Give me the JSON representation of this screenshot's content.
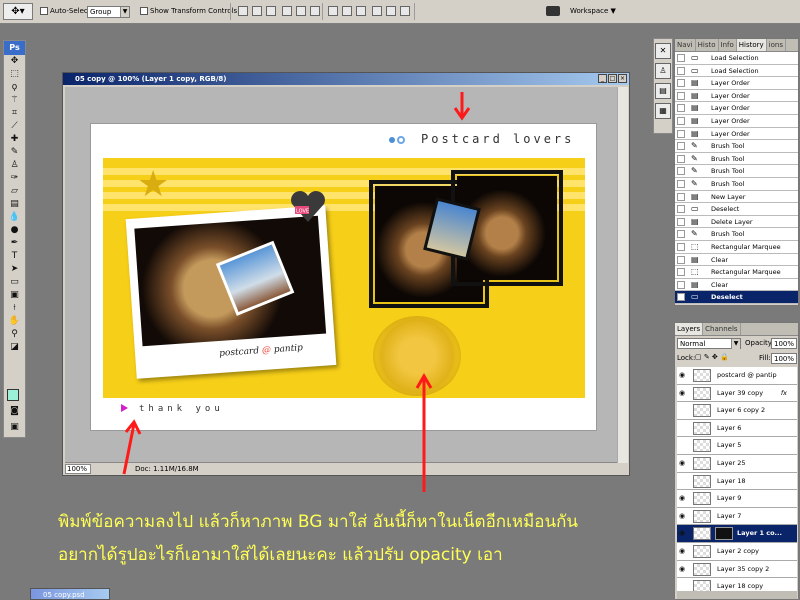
{
  "options_bar": {
    "tool_preset_icon": "move-tool-icon",
    "auto_select_label": "Auto-Select:",
    "auto_select_value": "Group",
    "show_transform_label": "Show Transform Controls",
    "workspace_label": "Workspace"
  },
  "toolbox": {
    "logo": "Ps",
    "foreground_color": "#9cf0d6",
    "tools": [
      "move-tool",
      "marquee-tool",
      "lasso-tool",
      "magic-wand-tool",
      "crop-tool",
      "slice-tool",
      "healing-brush-tool",
      "brush-tool",
      "clone-stamp-tool",
      "history-brush-tool",
      "eraser-tool",
      "gradient-tool",
      "blur-tool",
      "dodge-tool",
      "pen-tool",
      "type-tool",
      "path-selection-tool",
      "shape-tool",
      "notes-tool",
      "eyedropper-tool",
      "hand-tool",
      "zoom-tool"
    ]
  },
  "document": {
    "title": "05 copy @ 100% (Layer 1 copy, RGB/8)",
    "zoom": "100%",
    "doc_info": "Doc: 1.11M/16.8M",
    "brand_text": "Postcard lovers",
    "photo_caption_pre": "postcard",
    "photo_caption_at": "@",
    "photo_caption_post": "pantip",
    "heart_label": "LOVE",
    "thank_text": "thank you"
  },
  "history_panel": {
    "tabs": [
      "Navi",
      "Histo",
      "Info",
      "History",
      "ions"
    ],
    "active_tab": "History",
    "steps": [
      {
        "label": "Load Selection",
        "icon": "selection-icon"
      },
      {
        "label": "Load Selection",
        "icon": "selection-icon"
      },
      {
        "label": "Layer Order",
        "icon": "layer-icon"
      },
      {
        "label": "Layer Order",
        "icon": "layer-icon"
      },
      {
        "label": "Layer Order",
        "icon": "layer-icon"
      },
      {
        "label": "Layer Order",
        "icon": "layer-icon"
      },
      {
        "label": "Layer Order",
        "icon": "layer-icon"
      },
      {
        "label": "Brush Tool",
        "icon": "brush-icon"
      },
      {
        "label": "Brush Tool",
        "icon": "brush-icon"
      },
      {
        "label": "Brush Tool",
        "icon": "brush-icon"
      },
      {
        "label": "Brush Tool",
        "icon": "brush-icon"
      },
      {
        "label": "New Layer",
        "icon": "layer-icon"
      },
      {
        "label": "Deselect",
        "icon": "selection-icon"
      },
      {
        "label": "Delete Layer",
        "icon": "layer-icon"
      },
      {
        "label": "Brush Tool",
        "icon": "brush-icon"
      },
      {
        "label": "Rectangular Marquee",
        "icon": "marquee-icon"
      },
      {
        "label": "Clear",
        "icon": "layer-icon"
      },
      {
        "label": "Rectangular Marquee",
        "icon": "marquee-icon"
      },
      {
        "label": "Clear",
        "icon": "layer-icon"
      },
      {
        "label": "Deselect",
        "icon": "selection-icon",
        "current": true
      }
    ]
  },
  "layers_panel": {
    "tabs": [
      "Layers",
      "Channels"
    ],
    "blend_mode": "Normal",
    "opacity_label": "Opacity:",
    "opacity_value": "100%",
    "lock_label": "Lock:",
    "fill_label": "Fill:",
    "fill_value": "100%",
    "layers": [
      {
        "name": "postcard @ pantip",
        "visible": true
      },
      {
        "name": "Layer 39 copy",
        "visible": true,
        "fx": "fx"
      },
      {
        "name": "Layer 6 copy 2",
        "visible": false
      },
      {
        "name": "Layer 6",
        "visible": false
      },
      {
        "name": "Layer 5",
        "visible": false
      },
      {
        "name": "Layer 25",
        "visible": true
      },
      {
        "name": "Layer 18",
        "visible": false
      },
      {
        "name": "Layer 9",
        "visible": true
      },
      {
        "name": "Layer 7",
        "visible": true
      },
      {
        "name": "Layer 1 co...",
        "visible": true,
        "current": true
      },
      {
        "name": "Layer 2 copy",
        "visible": true
      },
      {
        "name": "Layer 35 copy 2",
        "visible": true
      },
      {
        "name": "Layer 18 copy",
        "visible": false
      }
    ]
  },
  "caption": {
    "line1": "พิมพ์ข้อความลงไป แล้วก็หาภาพ BG มาใส่ อันนี้ก็หาในเน็ตอีกเหมือนกัน",
    "line2": "อยากได้รูปอะไรก็เอามาใส่ได้เลยนะคะ แล้วปรับ opacity เอา",
    "color": "#ffff55"
  },
  "minimized_doc": "05 copy.psd",
  "colors": {
    "workspace_bg": "#7a7a7a",
    "chrome": "#d4d0c8",
    "selection": "#0a246a",
    "card_yellow": "#f6cf18",
    "arrow_red": "#ff1a1a"
  }
}
